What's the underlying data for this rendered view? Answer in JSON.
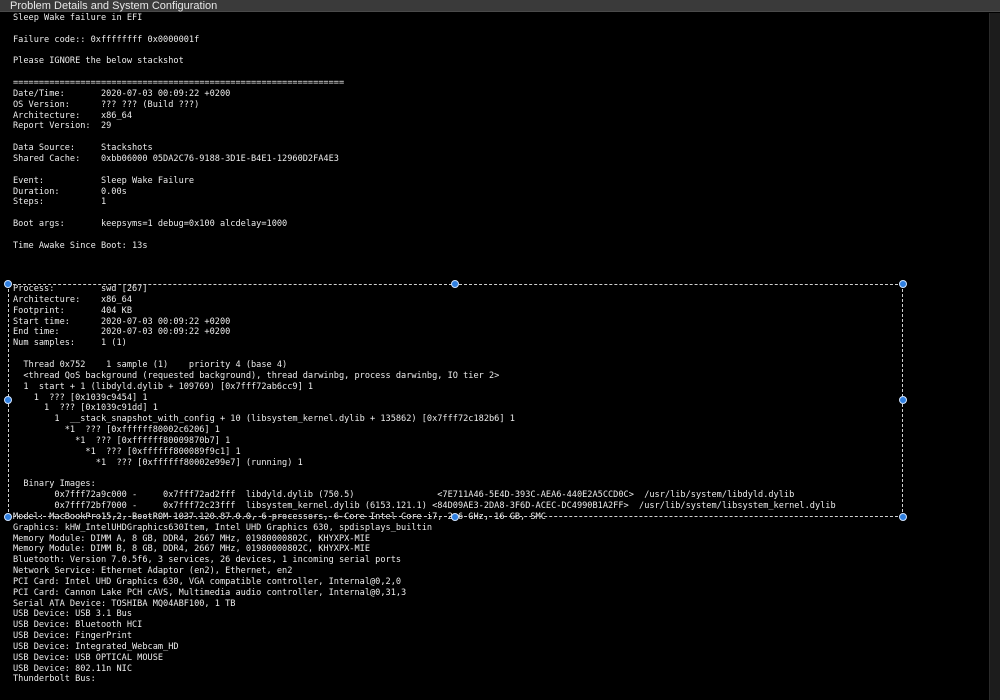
{
  "window": {
    "title": "Problem Details and System Configuration"
  },
  "report": {
    "lines": [
      "Sleep Wake failure in EFI",
      "",
      "Failure code:: 0xffffffff 0x0000001f",
      "",
      "Please IGNORE the below stackshot",
      "",
      "================================================================",
      "Date/Time:       2020-07-03 00:09:22 +0200",
      "OS Version:      ??? ??? (Build ???)",
      "Architecture:    x86_64",
      "Report Version:  29",
      "",
      "Data Source:     Stackshots",
      "Shared Cache:    0xbb06000 05DA2C76-9188-3D1E-B4E1-12960D2FA4E3",
      "",
      "Event:           Sleep Wake Failure",
      "Duration:        0.00s",
      "Steps:           1",
      "",
      "Boot args:       keepsyms=1 debug=0x100 alcdelay=1000",
      "",
      "Time Awake Since Boot: 13s",
      "",
      "",
      "",
      "Process:         swd [267]",
      "Architecture:    x86_64",
      "Footprint:       404 KB",
      "Start time:      2020-07-03 00:09:22 +0200",
      "End time:        2020-07-03 00:09:22 +0200",
      "Num samples:     1 (1)",
      "",
      "  Thread 0x752    1 sample (1)    priority 4 (base 4)",
      "  <thread QoS background (requested background), thread darwinbg, process darwinbg, IO tier 2>",
      "  1  start + 1 (libdyld.dylib + 109769) [0x7fff72ab6cc9] 1",
      "    1  ??? [0x1039c9454] 1",
      "      1  ??? [0x1039c91dd] 1",
      "        1  __stack_snapshot_with_config + 10 (libsystem_kernel.dylib + 135862) [0x7fff72c182b6] 1",
      "          *1  ??? [0xffffff80002c6206] 1",
      "            *1  ??? [0xffffff80009870b7] 1",
      "              *1  ??? [0xffffff800089f9c1] 1",
      "                *1  ??? [0xffffff80002e99e7] (running) 1",
      "",
      "  Binary Images:",
      "        0x7fff72a9c000 -     0x7fff72ad2fff  libdyld.dylib (750.5)                <7E711A46-5E4D-393C-AEA6-440E2A5CCD0C>  /usr/lib/system/libdyld.dylib",
      "        0x7fff72bf7000 -     0x7fff72c23fff  libsystem_kernel.dylib (6153.121.1) <84D09AE3-2DA8-3F6D-ACEC-DC4990B1A2FF>  /usr/lib/system/libsystem_kernel.dylib",
      "Model: MacBookPro15,2, BootROM 1037.120.87.0.0, 6 processors, 6-Core Intel Core i7, 2.6 GHz, 16 GB, SMC",
      "Graphics: kHW_IntelUHDGraphics630Item, Intel UHD Graphics 630, spdisplays_builtin",
      "Memory Module: DIMM A, 8 GB, DDR4, 2667 MHz, 01980000802C, KHYXPX-MIE",
      "Memory Module: DIMM B, 8 GB, DDR4, 2667 MHz, 01980000802C, KHYXPX-MIE",
      "Bluetooth: Version 7.0.5f6, 3 services, 26 devices, 1 incoming serial ports",
      "Network Service: Ethernet Adaptor (en2), Ethernet, en2",
      "PCI Card: Intel UHD Graphics 630, VGA compatible controller, Internal@0,2,0",
      "PCI Card: Cannon Lake PCH cAVS, Multimedia audio controller, Internal@0,31,3",
      "Serial ATA Device: TOSHIBA MQ04ABF100, 1 TB",
      "USB Device: USB 3.1 Bus",
      "USB Device: Bluetooth HCI",
      "USB Device: FingerPrint",
      "USB Device: Integrated_Webcam_HD",
      "USB Device: USB OPTICAL MOUSE",
      "USB Device: 802.11n NIC",
      "Thunderbolt Bus:"
    ]
  },
  "colors": {
    "background": "#000000",
    "text": "#ececec",
    "titlebar": "#3a3a3a",
    "handle": "#2f7fe0"
  }
}
